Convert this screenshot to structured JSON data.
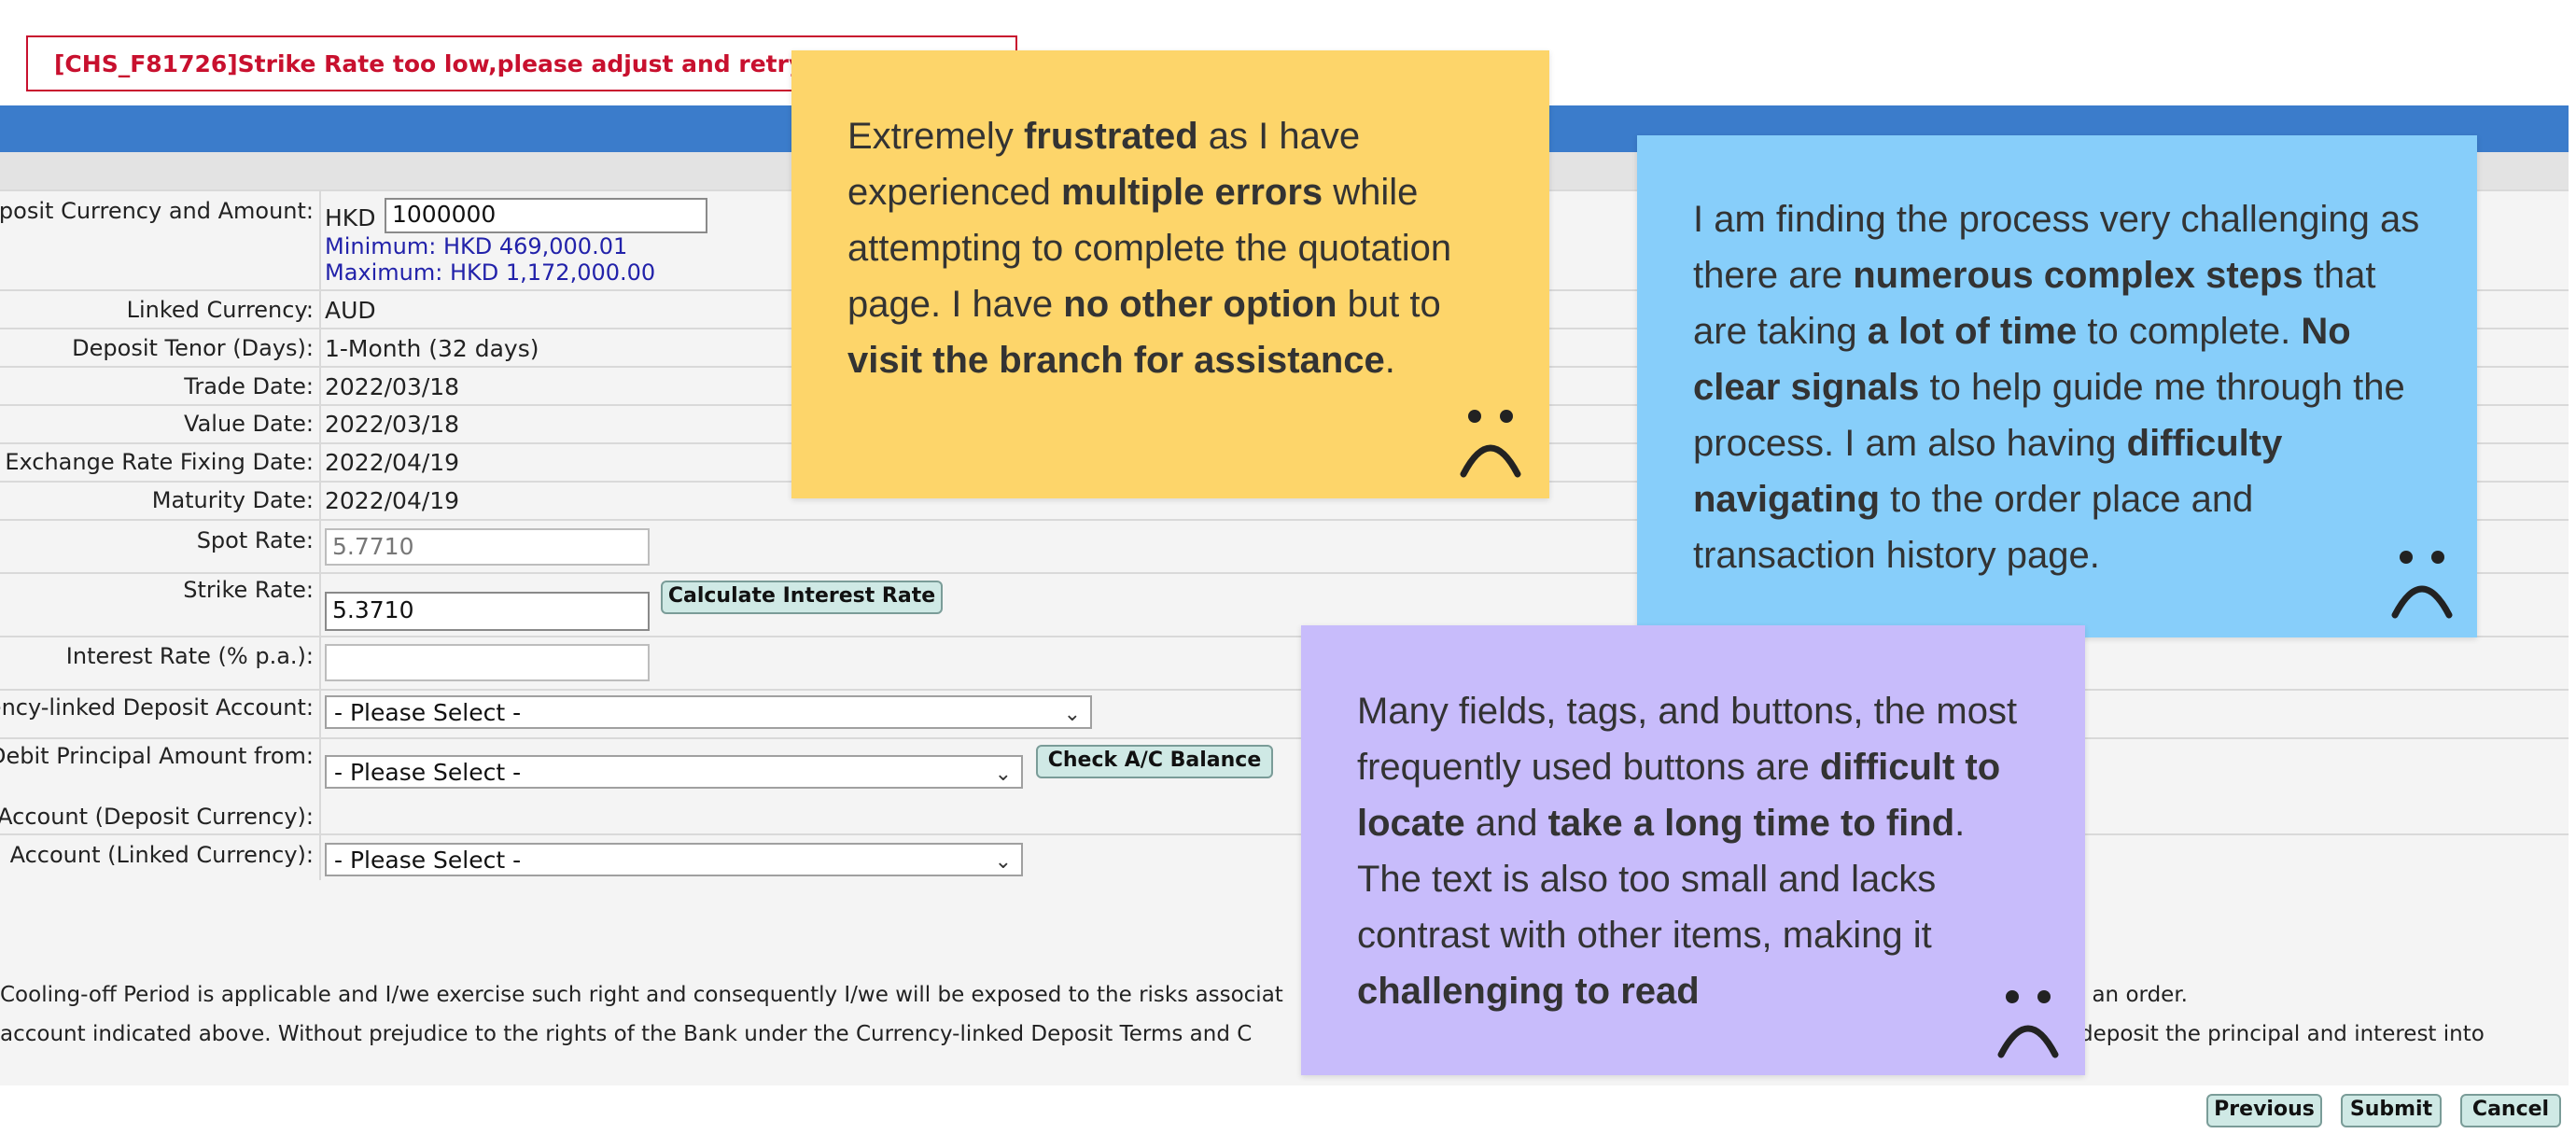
{
  "error": {
    "message": "[CHS_F81726]Strike Rate too low,please adjust and retry"
  },
  "form": {
    "deposit": {
      "label": "Deposit Currency and Amount:",
      "currency": "HKD",
      "amount": "1000000",
      "minimum": "Minimum: HKD 469,000.01",
      "maximum": "Maximum: HKD 1,172,000.00"
    },
    "linked_currency": {
      "label": "Linked Currency:",
      "value": "AUD"
    },
    "tenor": {
      "label": "Deposit Tenor (Days):",
      "value": "1-Month (32 days)"
    },
    "trade_date": {
      "label": "Trade Date:",
      "value": "2022/03/18"
    },
    "value_date": {
      "label": "Value Date:",
      "value": "2022/03/18"
    },
    "fixing_date": {
      "label": "Exchange Rate Fixing Date:",
      "value": "2022/04/19"
    },
    "maturity_date": {
      "label": "Maturity Date:",
      "value": "2022/04/19"
    },
    "spot_rate": {
      "label": "Spot Rate:",
      "value": "5.7710"
    },
    "strike_rate": {
      "label": "Strike Rate:",
      "value": "5.3710",
      "button": "Calculate Interest Rate"
    },
    "interest_rate": {
      "label": "Interest Rate (% p.a.):",
      "value": ""
    },
    "cld_account": {
      "label": "Currency-linked Deposit Account:",
      "selected": "- Please Select -"
    },
    "debit_from": {
      "label": "Debit Principal Amount from:",
      "selected": "- Please Select -",
      "button": "Check A/C Balance"
    },
    "account_deposit_ccy": {
      "label": "Account (Deposit Currency):"
    },
    "account_linked_ccy": {
      "label": "Account (Linked Currency):",
      "selected": "- Please Select -"
    }
  },
  "disclaimer": {
    "line1_left": "Cooling-off Period is applicable and I/we exercise such right and consequently I/we will be exposed to the risks associat",
    "line1_right": "e an order.",
    "line2_left": "account indicated above. Without prejudice to the rights of the Bank under the Currency-linked Deposit Terms and C",
    "line2_right": "deposit the principal and interest into"
  },
  "buttons": {
    "previous": "Previous",
    "submit": "Submit",
    "cancel": "Cancel"
  },
  "notes": {
    "yellow": {
      "color": "#fdd56a",
      "segments": [
        "Extremely ",
        "frustrated",
        " as I have experienced ",
        "multiple errors",
        " while attempting to complete the quotation page. I have ",
        "no other option",
        " but to ",
        "visit the branch for assistance",
        "."
      ],
      "icon": "sad-face-icon"
    },
    "blue": {
      "color": "#87cefa",
      "segments": [
        "I am finding the process very challenging as there are ",
        "numerous complex steps",
        " that are taking ",
        "a lot of time",
        " to complete. ",
        "No clear signals",
        " to help guide me through the process. I am also having ",
        "difficulty navigating",
        " to the order place and transaction history page."
      ],
      "icon": "sad-face-icon"
    },
    "purple": {
      "color": "#c8bcfb",
      "segments": [
        "Many fields, tags, and buttons, the most frequently used buttons are ",
        "difficult to locate",
        " and ",
        "take a long time to find",
        ". The text is also too small and lacks contrast with other items, making it ",
        "challenging to read"
      ],
      "icon": "sad-face-icon"
    }
  }
}
